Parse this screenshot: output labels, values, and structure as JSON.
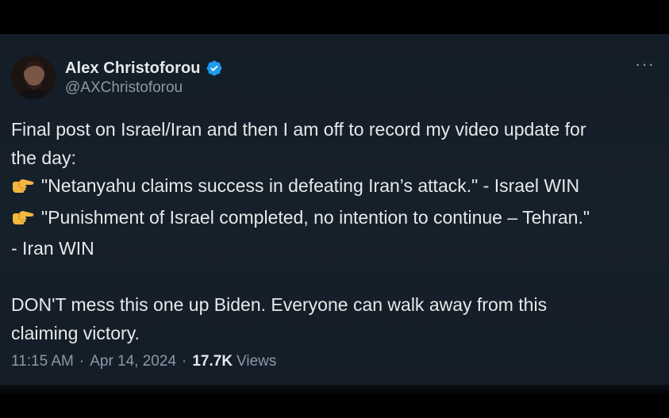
{
  "post": {
    "author": {
      "display_name": "Alex Christoforou",
      "handle": "@AXChristoforou",
      "verified": true,
      "avatar_icon": "user-avatar"
    },
    "more_label": "···",
    "body_lines": [
      "Final post on Israel/Iran and then I am off to record my video update for",
      "the day:",
      "\"Netanyahu claims success in defeating Iran’s attack.\" - Israel WIN",
      "\"Punishment of Israel completed, no intention to continue – Tehran.\"",
      "- Iran WIN",
      "DON'T mess this one up Biden. Everyone can walk away from this",
      "claiming victory."
    ],
    "bullet_icon": "pointing-right-hand-icon",
    "time": "11:15 AM",
    "separator": "·",
    "date": "Apr 14, 2024",
    "views_count": "17.7K",
    "views_label": "Views"
  },
  "colors": {
    "background": "#15202b",
    "text_primary": "#e7e9ea",
    "text_secondary": "#8b98a5",
    "verified_badge": "#1d9bf0"
  }
}
